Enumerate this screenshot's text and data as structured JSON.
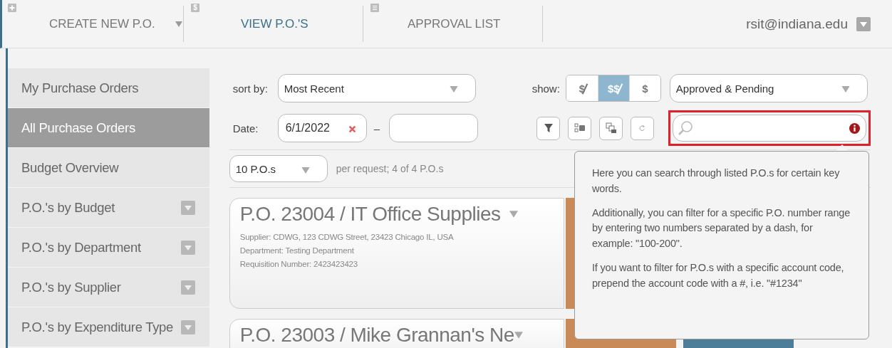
{
  "nav": {
    "tabs": [
      {
        "label": "CREATE NEW P.O.",
        "selected": false,
        "dropdown": true
      },
      {
        "label": "VIEW P.O.'S",
        "icon_glyph": "$",
        "selected": true,
        "dropdown": false
      },
      {
        "label": "APPROVAL LIST",
        "selected": false,
        "dropdown": false
      }
    ],
    "user": "rsit@indiana.edu"
  },
  "sidebar": {
    "items": [
      {
        "label": "My Purchase Orders",
        "selected": false,
        "expandable": false
      },
      {
        "label": "All Purchase Orders",
        "selected": true,
        "expandable": false
      },
      {
        "label": "Budget Overview",
        "selected": false,
        "expandable": false
      },
      {
        "label": "P.O.'s by Budget",
        "selected": false,
        "expandable": true
      },
      {
        "label": "P.O.'s by Department",
        "selected": false,
        "expandable": true
      },
      {
        "label": "P.O.'s by Supplier",
        "selected": false,
        "expandable": true
      },
      {
        "label": "P.O.'s by Expenditure Type",
        "selected": false,
        "expandable": true
      }
    ]
  },
  "filters": {
    "sort_label": "sort by:",
    "sort_value": "Most Recent",
    "date_label": "Date:",
    "date_from": "6/1/2022",
    "date_separator": "–",
    "show_label": "show:",
    "show_options": [
      {
        "label": "$",
        "struck": true,
        "selected": false
      },
      {
        "label": "$$",
        "struck": true,
        "selected": true
      },
      {
        "label": "$",
        "struck": false,
        "selected": false
      }
    ],
    "status_value": "Approved & Pending",
    "search": {
      "highlighted": true
    }
  },
  "paging": {
    "per_page": "10 P.O.s",
    "summary": "per request; 4 of 4 P.O.s"
  },
  "orders": [
    {
      "title": "P.O. 23004 / IT Office Supplies",
      "details": [
        "Supplier: CDWG, 123 CDWG Street, 23423 Chicago IL, USA",
        "Department: Testing Department",
        "Requisition Number: 2423423423"
      ]
    },
    {
      "title": "P.O. 23003 / Mike Grannan's Ne"
    }
  ],
  "tooltip": {
    "paragraphs": [
      "Here you can search through listed P.O.s for certain key words.",
      "Additionally, you can filter for a specific P.O. number range by entering two numbers separated by a dash, for example: \"100-200\".",
      "If you want to filter for P.O.s with a specific account code, prepend the account code with a #, i.e. \"#1234\""
    ]
  }
}
